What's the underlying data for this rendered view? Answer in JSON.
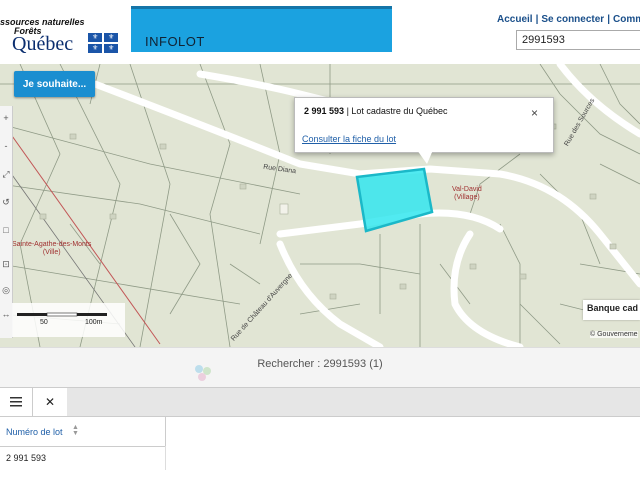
{
  "header": {
    "logo_line1": "ssources naturelles",
    "logo_line2": "Forêts",
    "logo_quebec": "Québec",
    "app_title": "INFOLOT",
    "links": [
      "Accueil",
      "Se connecter",
      "Comm"
    ],
    "search_value": "2991593"
  },
  "map": {
    "wish_button": "Je souhaite...",
    "popup": {
      "lot_number": "2 991 593",
      "lot_desc": "| Lot cadastre du Québec",
      "close": "×",
      "link": "Consulter la fiche du lot"
    },
    "places": [
      "Val-David\n(Village)",
      "Sainte-Agathe-des-Monts\n(Ville)"
    ],
    "roads": [
      "Rue Diana",
      "Rue des Sources",
      "Rue de Château d'Auvergne"
    ],
    "scale": {
      "left": "50",
      "right": "100m"
    },
    "banque_label": "Banque cad",
    "copyright": "© Gouverneme",
    "parcel_color": "#33e6ee",
    "tools": [
      "+",
      "-",
      "⤢",
      "↺",
      "□",
      "⊡",
      "◎",
      "↔"
    ]
  },
  "results": {
    "text": "Rechercher : 2991593 (1)"
  },
  "panel": {
    "close": "✕",
    "column_header": "Numéro de lot",
    "rows": [
      {
        "lot": "2 991 593"
      }
    ]
  }
}
